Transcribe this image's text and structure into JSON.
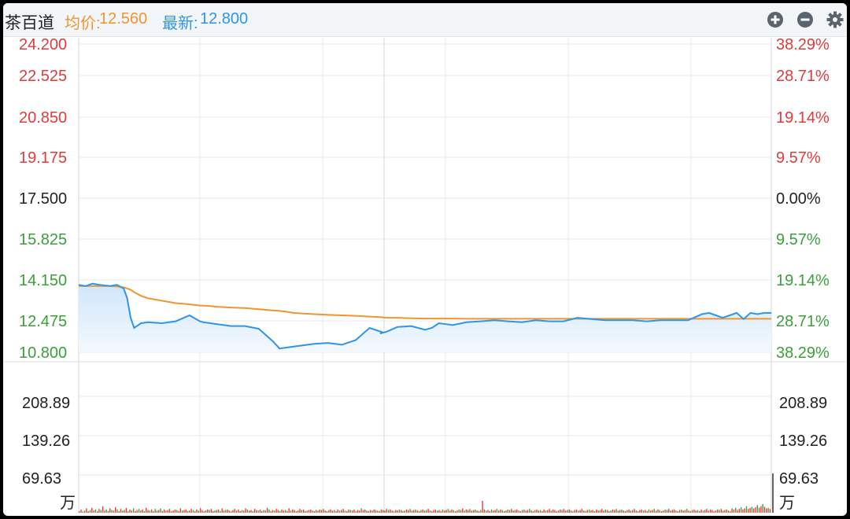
{
  "header": {
    "name": "茶百道",
    "avg_label": "均价:",
    "avg_value": "12.560",
    "last_label": "最新:",
    "last_value": "12.800"
  },
  "icons": {
    "zoom_in": "plus-circle-icon",
    "zoom_out": "minus-circle-icon",
    "settings": "gear-icon"
  },
  "colors": {
    "up": "#e23b3b",
    "down": "#3aa13a",
    "neutral": "#222222",
    "price_line": "#2f95e8",
    "avg_line": "#f0952f",
    "grid": "#e6e9ec"
  },
  "chart_data": [
    {
      "type": "line",
      "ylim": [
        10.8,
        24.2
      ],
      "y_ticks": [
        {
          "label": "24.200",
          "value": 24.2,
          "pct": "38.29%",
          "tone": "up"
        },
        {
          "label": "22.525",
          "value": 22.525,
          "pct": "28.71%",
          "tone": "up"
        },
        {
          "label": "20.850",
          "value": 20.85,
          "pct": "19.14%",
          "tone": "up"
        },
        {
          "label": "19.175",
          "value": 19.175,
          "pct": "9.57%",
          "tone": "up"
        },
        {
          "label": "17.500",
          "value": 17.5,
          "pct": "0.00%",
          "tone": "neutral"
        },
        {
          "label": "15.825",
          "value": 15.825,
          "pct": "9.57%",
          "tone": "down"
        },
        {
          "label": "14.150",
          "value": 14.15,
          "pct": "19.14%",
          "tone": "down"
        },
        {
          "label": "12.475",
          "value": 12.475,
          "pct": "28.71%",
          "tone": "down"
        },
        {
          "label": "10.800",
          "value": 10.8,
          "pct": "38.29%",
          "tone": "down"
        }
      ],
      "x": [
        0,
        0.01,
        0.02,
        0.03,
        0.045,
        0.055,
        0.065,
        0.07,
        0.075,
        0.08,
        0.09,
        0.1,
        0.12,
        0.14,
        0.16,
        0.175,
        0.18,
        0.19,
        0.2,
        0.22,
        0.24,
        0.26,
        0.28,
        0.29,
        0.3,
        0.31,
        0.32,
        0.34,
        0.36,
        0.38,
        0.4,
        0.42,
        0.44,
        0.435,
        0.445,
        0.46,
        0.48,
        0.5,
        0.51,
        0.52,
        0.54,
        0.56,
        0.58,
        0.6,
        0.62,
        0.64,
        0.66,
        0.68,
        0.7,
        0.72,
        0.74,
        0.76,
        0.78,
        0.8,
        0.82,
        0.84,
        0.86,
        0.88,
        0.9,
        0.91,
        0.92,
        0.93,
        0.94,
        0.95,
        0.96,
        0.97,
        0.98,
        0.99,
        1.0
      ],
      "series": [
        {
          "values": [
            13.95,
            13.9,
            14.0,
            13.95,
            13.9,
            13.95,
            13.8,
            13.4,
            12.6,
            12.1,
            12.35,
            12.4,
            12.35,
            12.45,
            12.7,
            12.45,
            12.4,
            12.35,
            12.3,
            12.2,
            12.2,
            12.05,
            11.4,
            11.0,
            11.05,
            11.1,
            11.15,
            11.25,
            11.3,
            11.2,
            11.45,
            12.1,
            11.85,
            11.8,
            11.9,
            12.15,
            12.2,
            12.0,
            12.1,
            12.35,
            12.25,
            12.4,
            12.45,
            12.5,
            12.45,
            12.4,
            12.5,
            12.45,
            12.45,
            12.6,
            12.55,
            12.5,
            12.5,
            12.5,
            12.45,
            12.5,
            12.5,
            12.5,
            12.75,
            12.8,
            12.7,
            12.6,
            12.7,
            12.8,
            12.55,
            12.8,
            12.75,
            12.8,
            12.8
          ]
        },
        {
          "values": [
            13.9,
            13.9,
            13.9,
            13.9,
            13.9,
            13.88,
            13.85,
            13.8,
            13.75,
            13.65,
            13.5,
            13.4,
            13.3,
            13.2,
            13.15,
            13.1,
            13.1,
            13.08,
            13.05,
            13.02,
            13.0,
            12.95,
            12.9,
            12.88,
            12.85,
            12.8,
            12.78,
            12.75,
            12.72,
            12.7,
            12.68,
            12.65,
            12.62,
            12.62,
            12.6,
            12.6,
            12.58,
            12.57,
            12.57,
            12.57,
            12.57,
            12.56,
            12.56,
            12.56,
            12.56,
            12.56,
            12.56,
            12.56,
            12.56,
            12.56,
            12.56,
            12.56,
            12.56,
            12.56,
            12.56,
            12.56,
            12.56,
            12.56,
            12.56,
            12.56,
            12.56,
            12.56,
            12.56,
            12.56,
            12.56,
            12.56,
            12.56,
            12.56,
            12.56
          ]
        }
      ]
    },
    {
      "type": "bar",
      "ylim": [
        0,
        278.52
      ],
      "y_ticks": [
        "208.89",
        "139.26",
        "69.63"
      ],
      "unit": "万",
      "volumes": [
        3,
        6,
        2,
        4,
        8,
        3,
        5,
        9,
        4,
        6,
        3,
        7,
        5,
        12,
        4,
        6,
        3,
        8,
        5,
        4,
        10,
        6,
        3,
        7,
        4,
        5,
        9,
        3,
        6,
        4,
        8,
        3,
        5,
        7,
        4,
        6,
        3,
        9,
        5,
        4,
        6,
        3,
        7,
        4,
        5,
        8,
        3,
        6,
        4,
        5,
        7,
        3,
        4,
        6,
        5,
        3,
        8,
        4,
        5,
        6,
        3,
        4,
        7,
        5,
        3,
        6,
        4,
        8,
        5,
        3,
        4,
        6,
        5,
        7,
        3,
        4,
        5,
        6,
        3,
        8,
        4,
        5,
        6,
        4,
        3,
        5,
        7,
        4,
        6,
        3,
        5,
        4,
        8,
        6,
        4,
        5,
        3,
        7,
        5,
        4,
        6,
        3,
        5,
        4,
        9,
        6,
        3,
        5,
        4,
        7,
        5,
        3,
        6,
        4,
        5,
        3,
        8,
        4,
        6,
        5,
        3,
        4,
        7,
        5,
        6,
        3,
        4,
        5,
        6,
        4,
        3,
        5,
        4,
        6,
        5,
        7,
        4,
        3,
        5,
        6,
        4,
        5,
        3,
        6,
        4,
        5,
        7,
        4,
        3,
        6,
        5,
        4,
        6,
        3,
        5,
        4,
        8,
        5,
        6,
        4,
        3,
        5,
        4,
        6,
        5,
        4,
        3,
        6,
        5,
        4,
        7,
        5,
        6,
        4,
        3,
        5,
        4,
        6,
        5,
        3,
        4,
        6,
        5,
        7,
        4,
        5,
        6,
        4,
        3,
        5,
        6,
        4,
        5,
        7,
        4,
        3,
        5,
        6,
        4,
        5,
        3,
        6,
        4,
        5,
        7,
        4,
        6,
        5,
        3,
        4,
        6,
        5,
        8,
        4,
        6,
        5,
        7,
        4,
        5,
        6,
        4,
        3,
        5,
        22,
        6,
        4,
        5,
        3,
        6,
        4,
        5,
        7,
        4,
        6,
        5,
        3,
        4,
        6,
        5,
        7,
        4,
        5,
        6,
        4,
        3,
        5,
        6,
        4,
        5,
        7,
        4,
        3,
        5,
        6,
        4,
        5,
        3,
        6,
        4,
        5,
        7,
        4,
        6,
        5,
        3,
        4,
        6,
        5,
        7,
        4,
        5,
        6,
        4,
        3,
        5,
        6,
        4,
        5,
        7,
        4,
        3,
        5,
        6,
        4,
        5,
        3,
        6,
        4,
        5,
        7,
        4,
        6,
        5,
        3,
        4,
        6,
        5,
        7,
        4,
        5,
        6,
        4,
        3,
        5,
        6,
        4,
        5,
        7,
        4,
        3,
        5,
        6,
        4,
        5,
        3,
        6,
        4,
        5,
        7,
        4,
        6,
        5,
        3,
        4,
        6,
        5,
        7,
        4,
        5,
        6,
        4,
        3,
        5,
        6,
        4,
        5,
        7,
        4,
        3,
        5,
        6,
        4,
        5,
        3,
        6,
        4,
        5,
        7,
        4,
        6,
        5,
        3,
        4,
        6,
        5,
        7,
        4,
        5,
        6,
        4,
        3,
        8,
        6,
        9,
        5,
        7,
        10,
        6,
        8,
        12,
        7,
        9,
        11,
        8,
        10,
        14,
        9,
        12,
        16,
        11,
        8,
        9,
        7
      ],
      "volume_tones": "alternating"
    }
  ]
}
